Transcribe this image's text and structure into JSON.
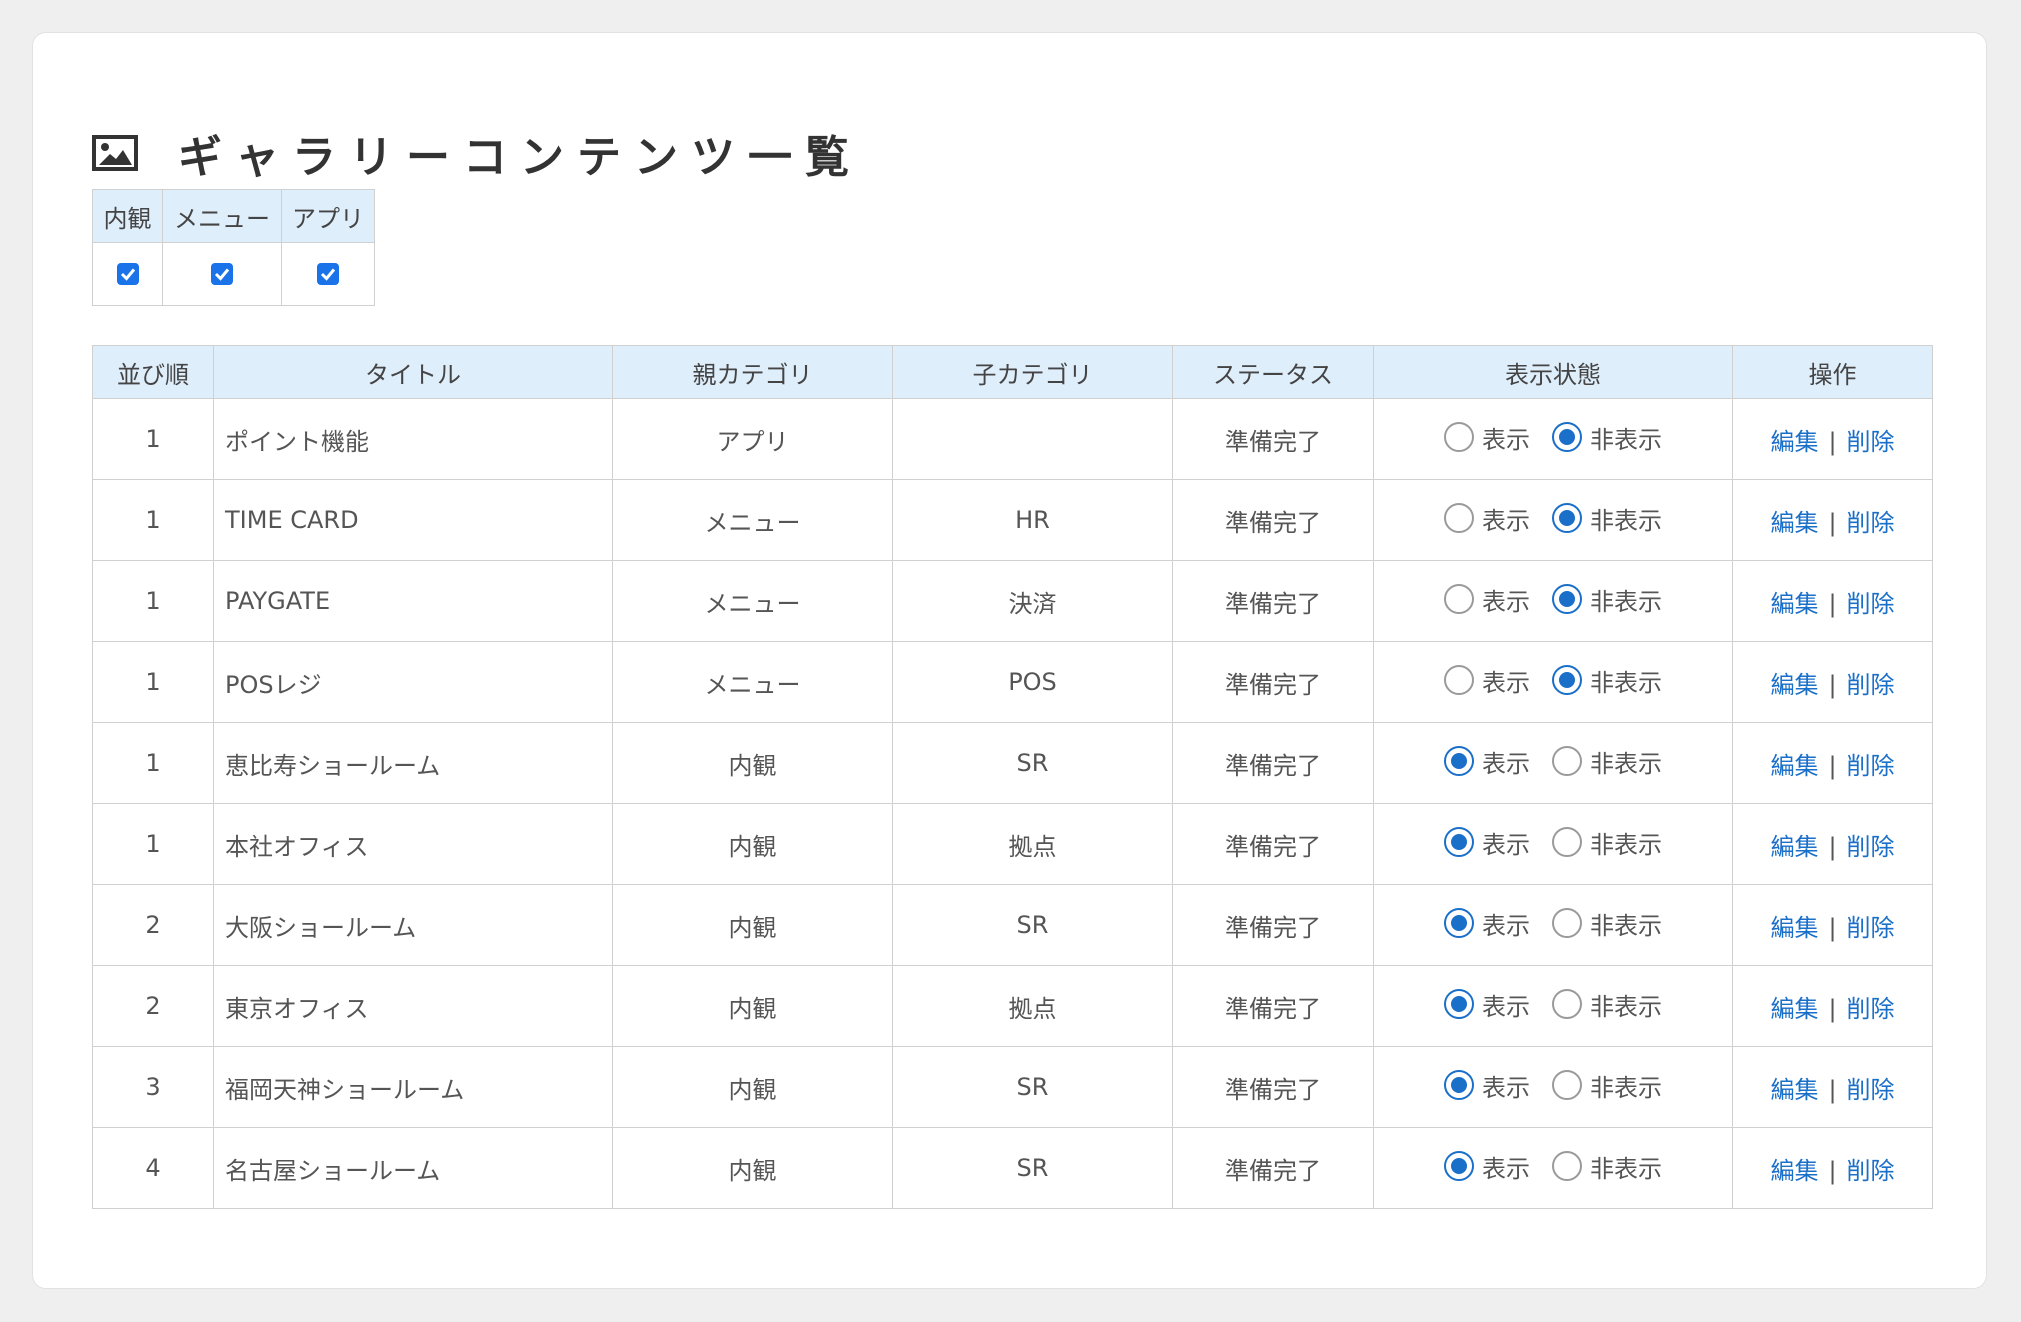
{
  "page": {
    "title": "ギャラリーコンテンツ一覧"
  },
  "filter": {
    "columns": [
      "内観",
      "メニュー",
      "アプリ"
    ],
    "checked": [
      true,
      true,
      true
    ]
  },
  "table": {
    "headers": [
      "並び順",
      "タイトル",
      "親カテゴリ",
      "子カテゴリ",
      "ステータス",
      "表示状態",
      "操作"
    ],
    "radio_show_label": "表示",
    "radio_hide_label": "非表示",
    "edit_label": "編集",
    "delete_label": "削除",
    "separator": "|",
    "rows": [
      {
        "order": "1",
        "title": "ポイント機能",
        "parent": "アプリ",
        "child": "",
        "status": "準備完了",
        "visible": false
      },
      {
        "order": "1",
        "title": "TIME CARD",
        "parent": "メニュー",
        "child": "HR",
        "status": "準備完了",
        "visible": false
      },
      {
        "order": "1",
        "title": "PAYGATE",
        "parent": "メニュー",
        "child": "決済",
        "status": "準備完了",
        "visible": false
      },
      {
        "order": "1",
        "title": "POSレジ",
        "parent": "メニュー",
        "child": "POS",
        "status": "準備完了",
        "visible": false
      },
      {
        "order": "1",
        "title": "恵比寿ショールーム",
        "parent": "内観",
        "child": "SR",
        "status": "準備完了",
        "visible": true
      },
      {
        "order": "1",
        "title": "本社オフィス",
        "parent": "内観",
        "child": "拠点",
        "status": "準備完了",
        "visible": true
      },
      {
        "order": "2",
        "title": "大阪ショールーム",
        "parent": "内観",
        "child": "SR",
        "status": "準備完了",
        "visible": true
      },
      {
        "order": "2",
        "title": "東京オフィス",
        "parent": "内観",
        "child": "拠点",
        "status": "準備完了",
        "visible": true
      },
      {
        "order": "3",
        "title": "福岡天神ショールーム",
        "parent": "内観",
        "child": "SR",
        "status": "準備完了",
        "visible": true
      },
      {
        "order": "4",
        "title": "名古屋ショールーム",
        "parent": "内観",
        "child": "SR",
        "status": "準備完了",
        "visible": true
      }
    ]
  }
}
